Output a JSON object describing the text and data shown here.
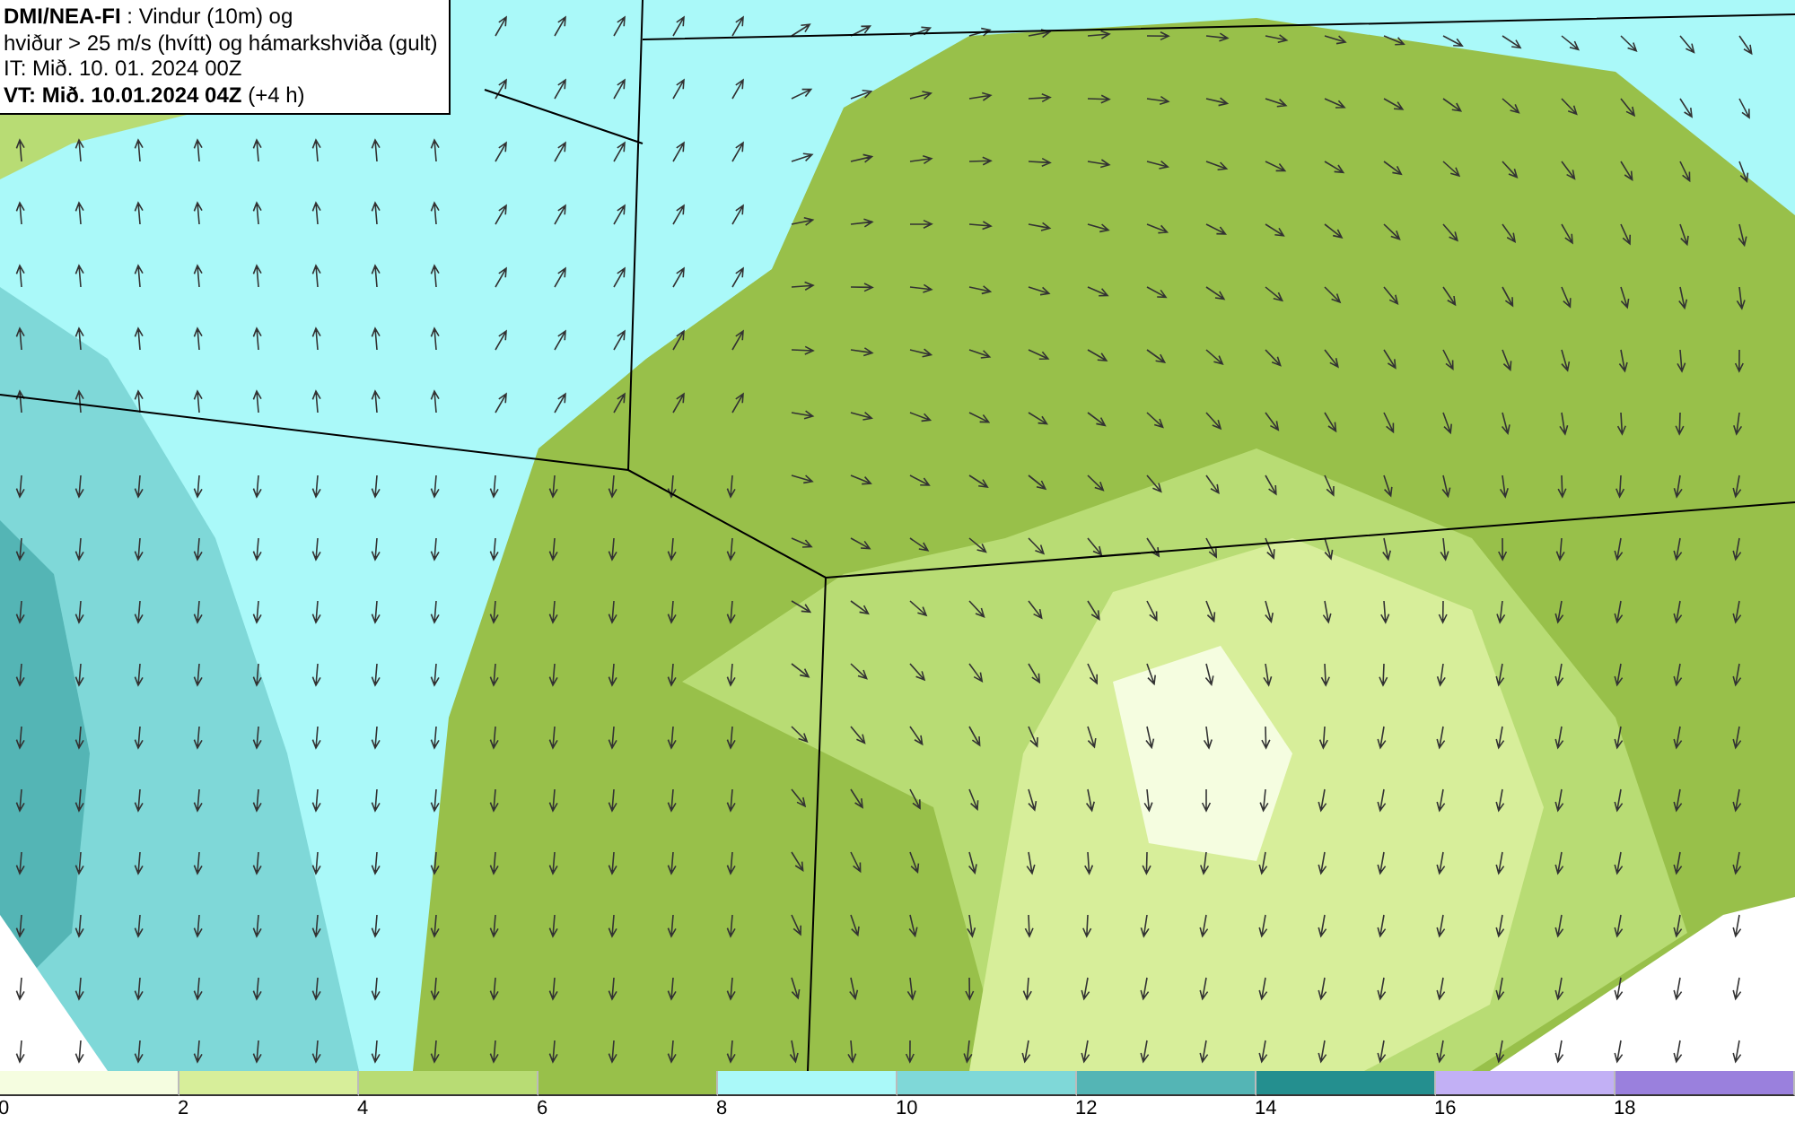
{
  "title_box": {
    "lines": [
      "**DMI/NEA-FI** : Vindur (10m) og",
      "hviður > 25 m/s (hvítt) og hámarkshviða (gult)",
      "IT: Mið. 10. 01. 2024 00Z",
      "**VT: Mið. 10.01.2024 04Z** (+4 h)"
    ]
  },
  "legend": {
    "segments": [
      {
        "color": "#f5fde0",
        "tick": "0"
      },
      {
        "color": "#d7ee9a",
        "tick": "2"
      },
      {
        "color": "#b8dc74",
        "tick": "4"
      },
      {
        "color": "#98c04a",
        "tick": "6"
      },
      {
        "color": "#aaf9f9",
        "tick": "8"
      },
      {
        "color": "#7fd8d8",
        "tick": "10"
      },
      {
        "color": "#54b5b5",
        "tick": "12"
      },
      {
        "color": "#248f8f",
        "tick": "14"
      },
      {
        "color": "#c2b0f5",
        "tick": "16"
      },
      {
        "color": "#9a80dd",
        "tick": "18"
      }
    ]
  }
}
